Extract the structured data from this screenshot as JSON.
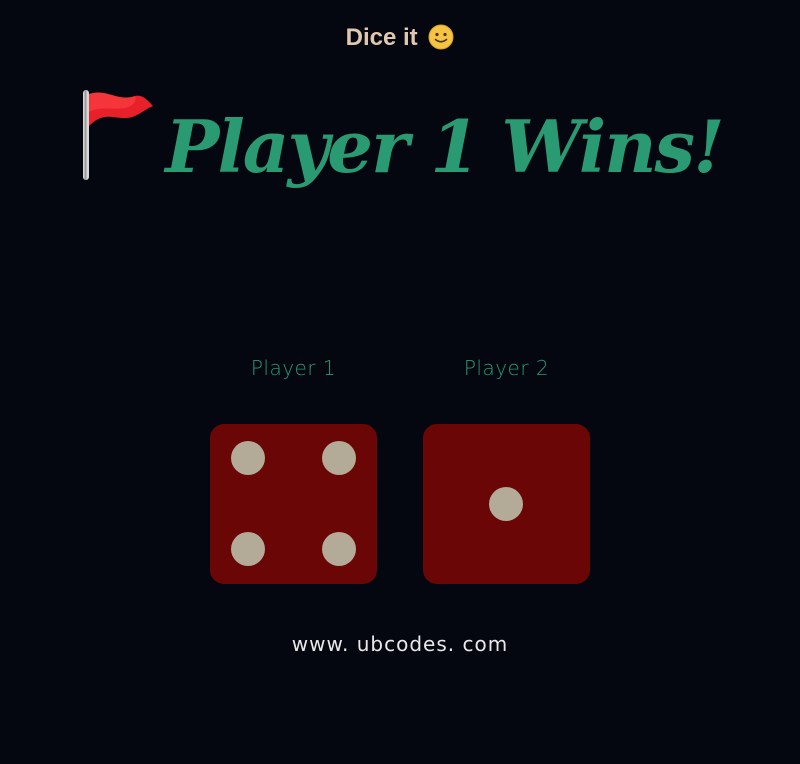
{
  "app": {
    "title": "Dice it",
    "title_icon": "slightly-smiling-face-icon"
  },
  "result": {
    "icon": "triangular-flag-icon",
    "text": "Player 1 Wins!",
    "color": "#2a9a72"
  },
  "players": [
    {
      "label": "Player 1",
      "die_value": 4
    },
    {
      "label": "Player 2",
      "die_value": 1
    }
  ],
  "colors": {
    "background": "#04070f",
    "die": "#6b0606",
    "pip": "#b3aa98",
    "accent": "#2a9a72"
  },
  "footer": {
    "text": "www. ubcodes. com"
  }
}
